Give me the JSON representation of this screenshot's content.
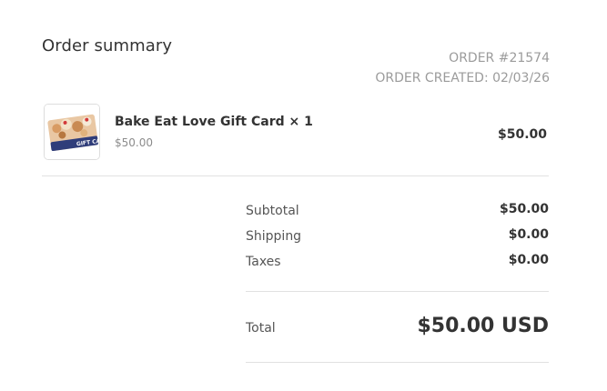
{
  "header": {
    "title": "Order summary",
    "order_number": "ORDER #21574",
    "order_created": "ORDER CREATED: 02/03/26"
  },
  "line_items": [
    {
      "name": "Bake Eat Love Gift Card × 1",
      "unit_price": "$50.00",
      "line_total": "$50.00",
      "thumbnail_text": "GIFT CARD"
    }
  ],
  "summary": {
    "subtotal_label": "Subtotal",
    "subtotal_value": "$50.00",
    "shipping_label": "Shipping",
    "shipping_value": "$0.00",
    "taxes_label": "Taxes",
    "taxes_value": "$0.00",
    "total_label": "Total",
    "total_value": "$50.00 USD"
  },
  "colors": {
    "text": "#333333",
    "muted": "#9b9b9b",
    "divider": "#e1e1e1",
    "card_navy": "#2f3d7a"
  }
}
